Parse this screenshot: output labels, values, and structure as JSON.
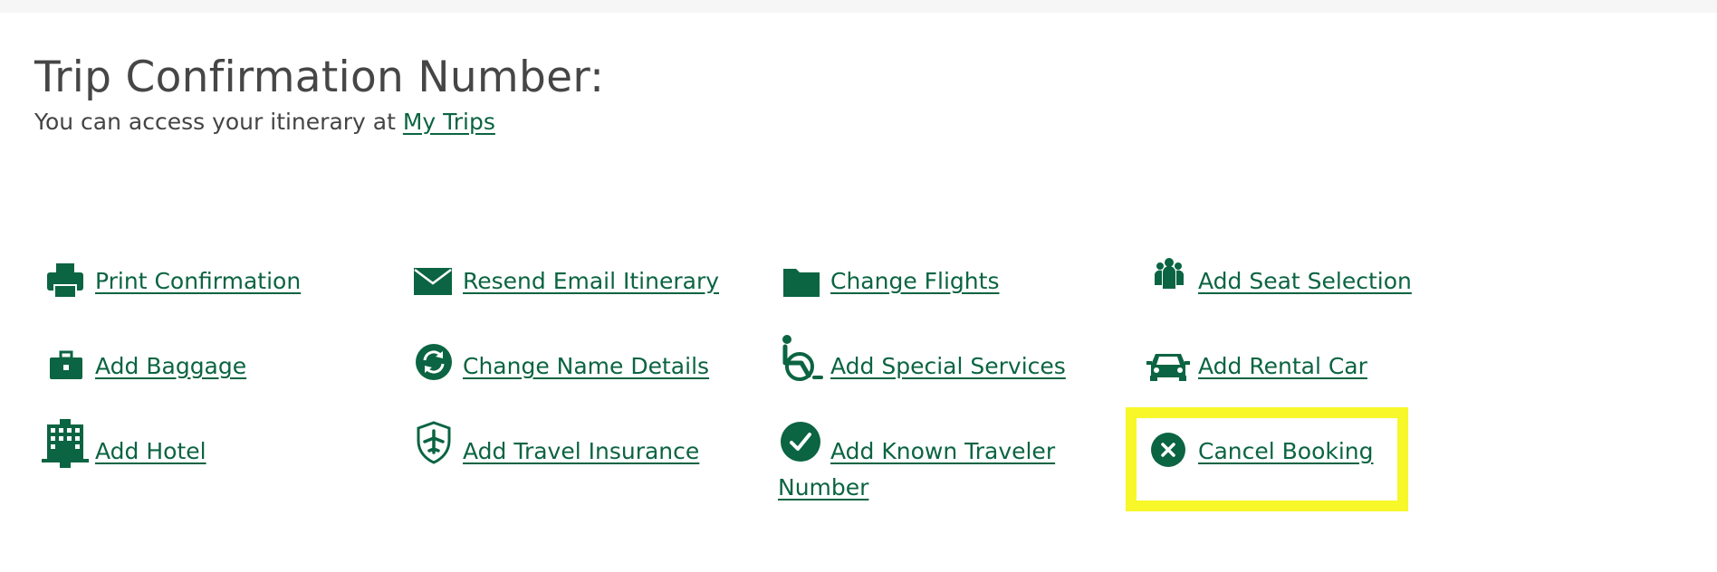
{
  "page": {
    "title": "Trip Confirmation Number:",
    "subtitle_prefix": "You can access your itinerary at ",
    "my_trips_link": "My Trips"
  },
  "actions": {
    "print_confirmation": "Print Confirmation",
    "resend_email": "Resend Email Itinerary",
    "change_flights": "Change Flights",
    "add_seat_selection": "Add Seat Selection",
    "add_baggage": "Add Baggage",
    "change_name": "Change Name Details",
    "add_special_services": "Add Special Services",
    "add_rental_car": "Add Rental Car",
    "add_hotel": "Add Hotel",
    "add_travel_insurance": "Add Travel Insurance",
    "add_known_traveler": "Add Known Traveler Number",
    "cancel_booking": "Cancel Booking"
  },
  "icons": {
    "print_confirmation": "printer-icon",
    "resend_email": "envelope-icon",
    "change_flights": "folder-icon",
    "add_seat_selection": "people-group-icon",
    "add_baggage": "briefcase-icon",
    "change_name": "refresh-icon",
    "add_special_services": "wheelchair-icon",
    "add_rental_car": "car-icon",
    "add_hotel": "hotel-building-icon",
    "add_travel_insurance": "shield-plane-icon",
    "add_known_traveler": "check-circle-icon",
    "cancel_booking": "close-circle-icon"
  },
  "colors": {
    "brand_green": "#0b6442",
    "highlight_yellow": "#f7f72a",
    "text": "#444444"
  }
}
